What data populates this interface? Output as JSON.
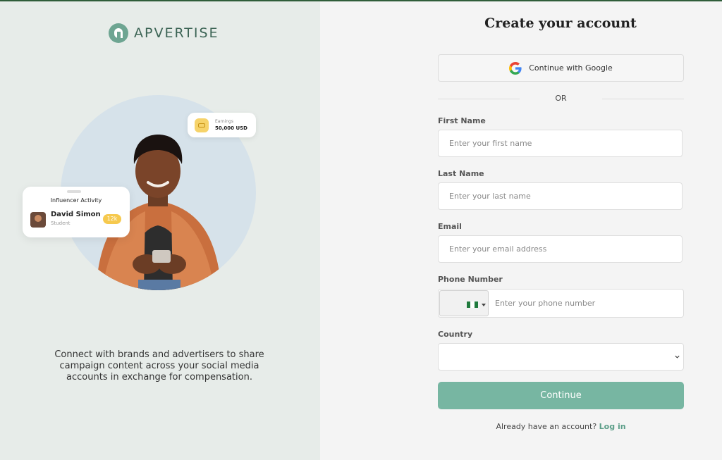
{
  "brand": {
    "name": "APVERTISE",
    "accent": "#6ea592"
  },
  "hero": {
    "earnings_label": "Earnings",
    "earnings_value": "50,000 USD",
    "activity_title": "Influencer Activity",
    "activity_name": "David Simon",
    "activity_role": "Student",
    "activity_badge": "12k",
    "tagline": "Connect with brands and advertisers to share campaign content across your social media accounts in exchange for compensation."
  },
  "form": {
    "title": "Create your account",
    "google_label": "Continue with Google",
    "or_text": "OR",
    "first_name_label": "First Name",
    "first_name_placeholder": "Enter your first name",
    "last_name_label": "Last Name",
    "last_name_placeholder": "Enter your last name",
    "email_label": "Email",
    "email_placeholder": "Enter your email address",
    "phone_label": "Phone Number",
    "phone_placeholder": "Enter your phone number",
    "phone_flag": "nigeria-flag-icon",
    "country_label": "Country",
    "country_value": "",
    "continue_label": "Continue",
    "login_prompt": "Already have an account?",
    "login_link": "Log in",
    "button_color": "#77b6a2"
  }
}
